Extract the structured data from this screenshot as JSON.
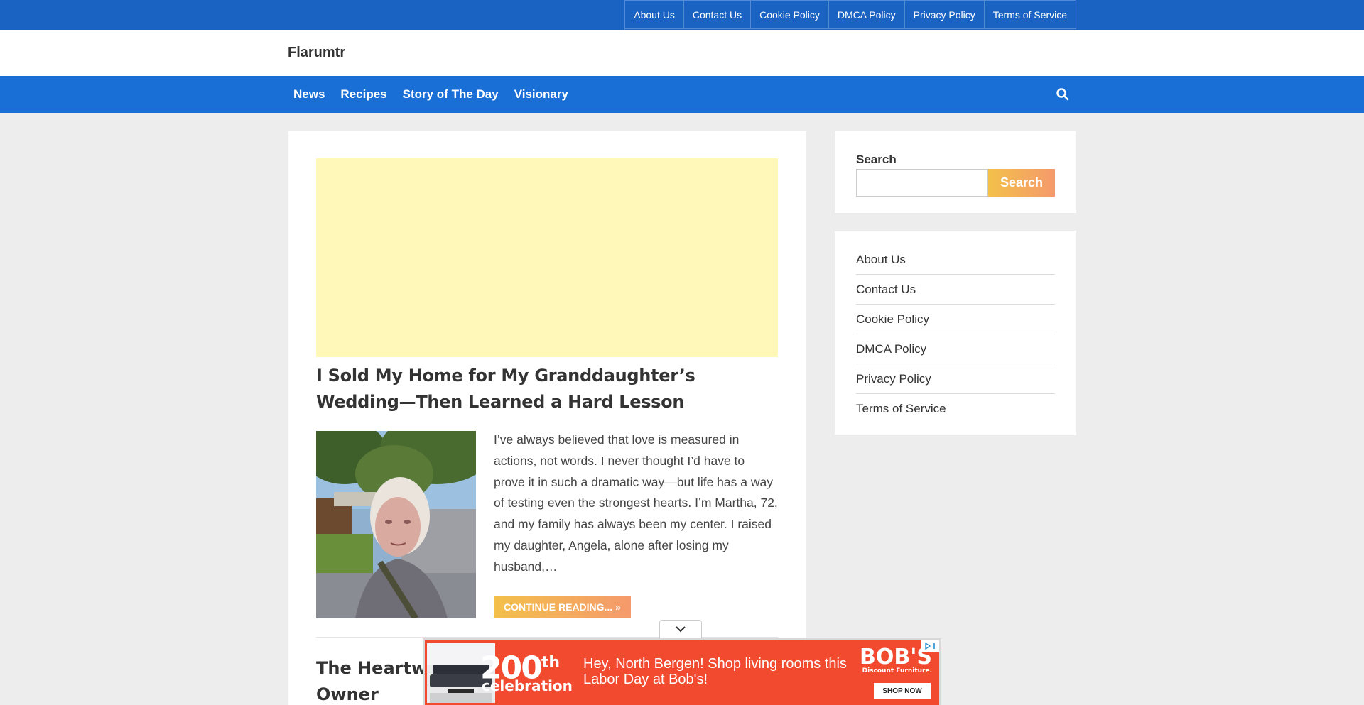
{
  "top_nav": {
    "items": [
      "About Us",
      "Contact Us",
      "Cookie Policy",
      "DMCA Policy",
      "Privacy Policy",
      "Terms of Service"
    ]
  },
  "site": {
    "title": "Flarumtr"
  },
  "main_nav": {
    "items": [
      "News",
      "Recipes",
      "Story of The Day",
      "Visionary"
    ],
    "search_icon": "search-icon"
  },
  "posts": [
    {
      "title": "I Sold My Home for My Granddaughter’s Wedding—Then Learned a Hard Lesson",
      "excerpt": "I’ve always believed that love is measured in actions, not words. I never thought I’d have to prove it in such a dramatic way—but life has a way of testing even the strongest hearts. I’m Martha, 72, and my family has always been my center. I raised my daughter, Angela, alone after losing my husband,…",
      "read_more": "CONTINUE READING... »"
    },
    {
      "title": "The Heartwar",
      "title_line2": "Owner"
    }
  ],
  "sidebar": {
    "search": {
      "label": "Search",
      "button": "Search",
      "value": ""
    },
    "links": [
      "About Us",
      "Contact Us",
      "Cookie Policy",
      "DMCA Policy",
      "Privacy Policy",
      "Terms of Service"
    ]
  },
  "bottom_ad": {
    "big_number": "200",
    "big_suffix": "th",
    "big_sub": "celebration",
    "text": "Hey, North Bergen! Shop living rooms this Labor Day at Bob's!",
    "brand": "BOB'S",
    "brand_sub": "Discount Furniture.",
    "cta": "SHOP NOW"
  },
  "colors": {
    "topbar": "#1a63c2",
    "nav": "#1a6fd6",
    "ad_placeholder": "#fff8b8",
    "button_gradient_start": "#f3c04a",
    "button_gradient_end": "#f59a6c",
    "ad_bg": "#f24a2e"
  }
}
